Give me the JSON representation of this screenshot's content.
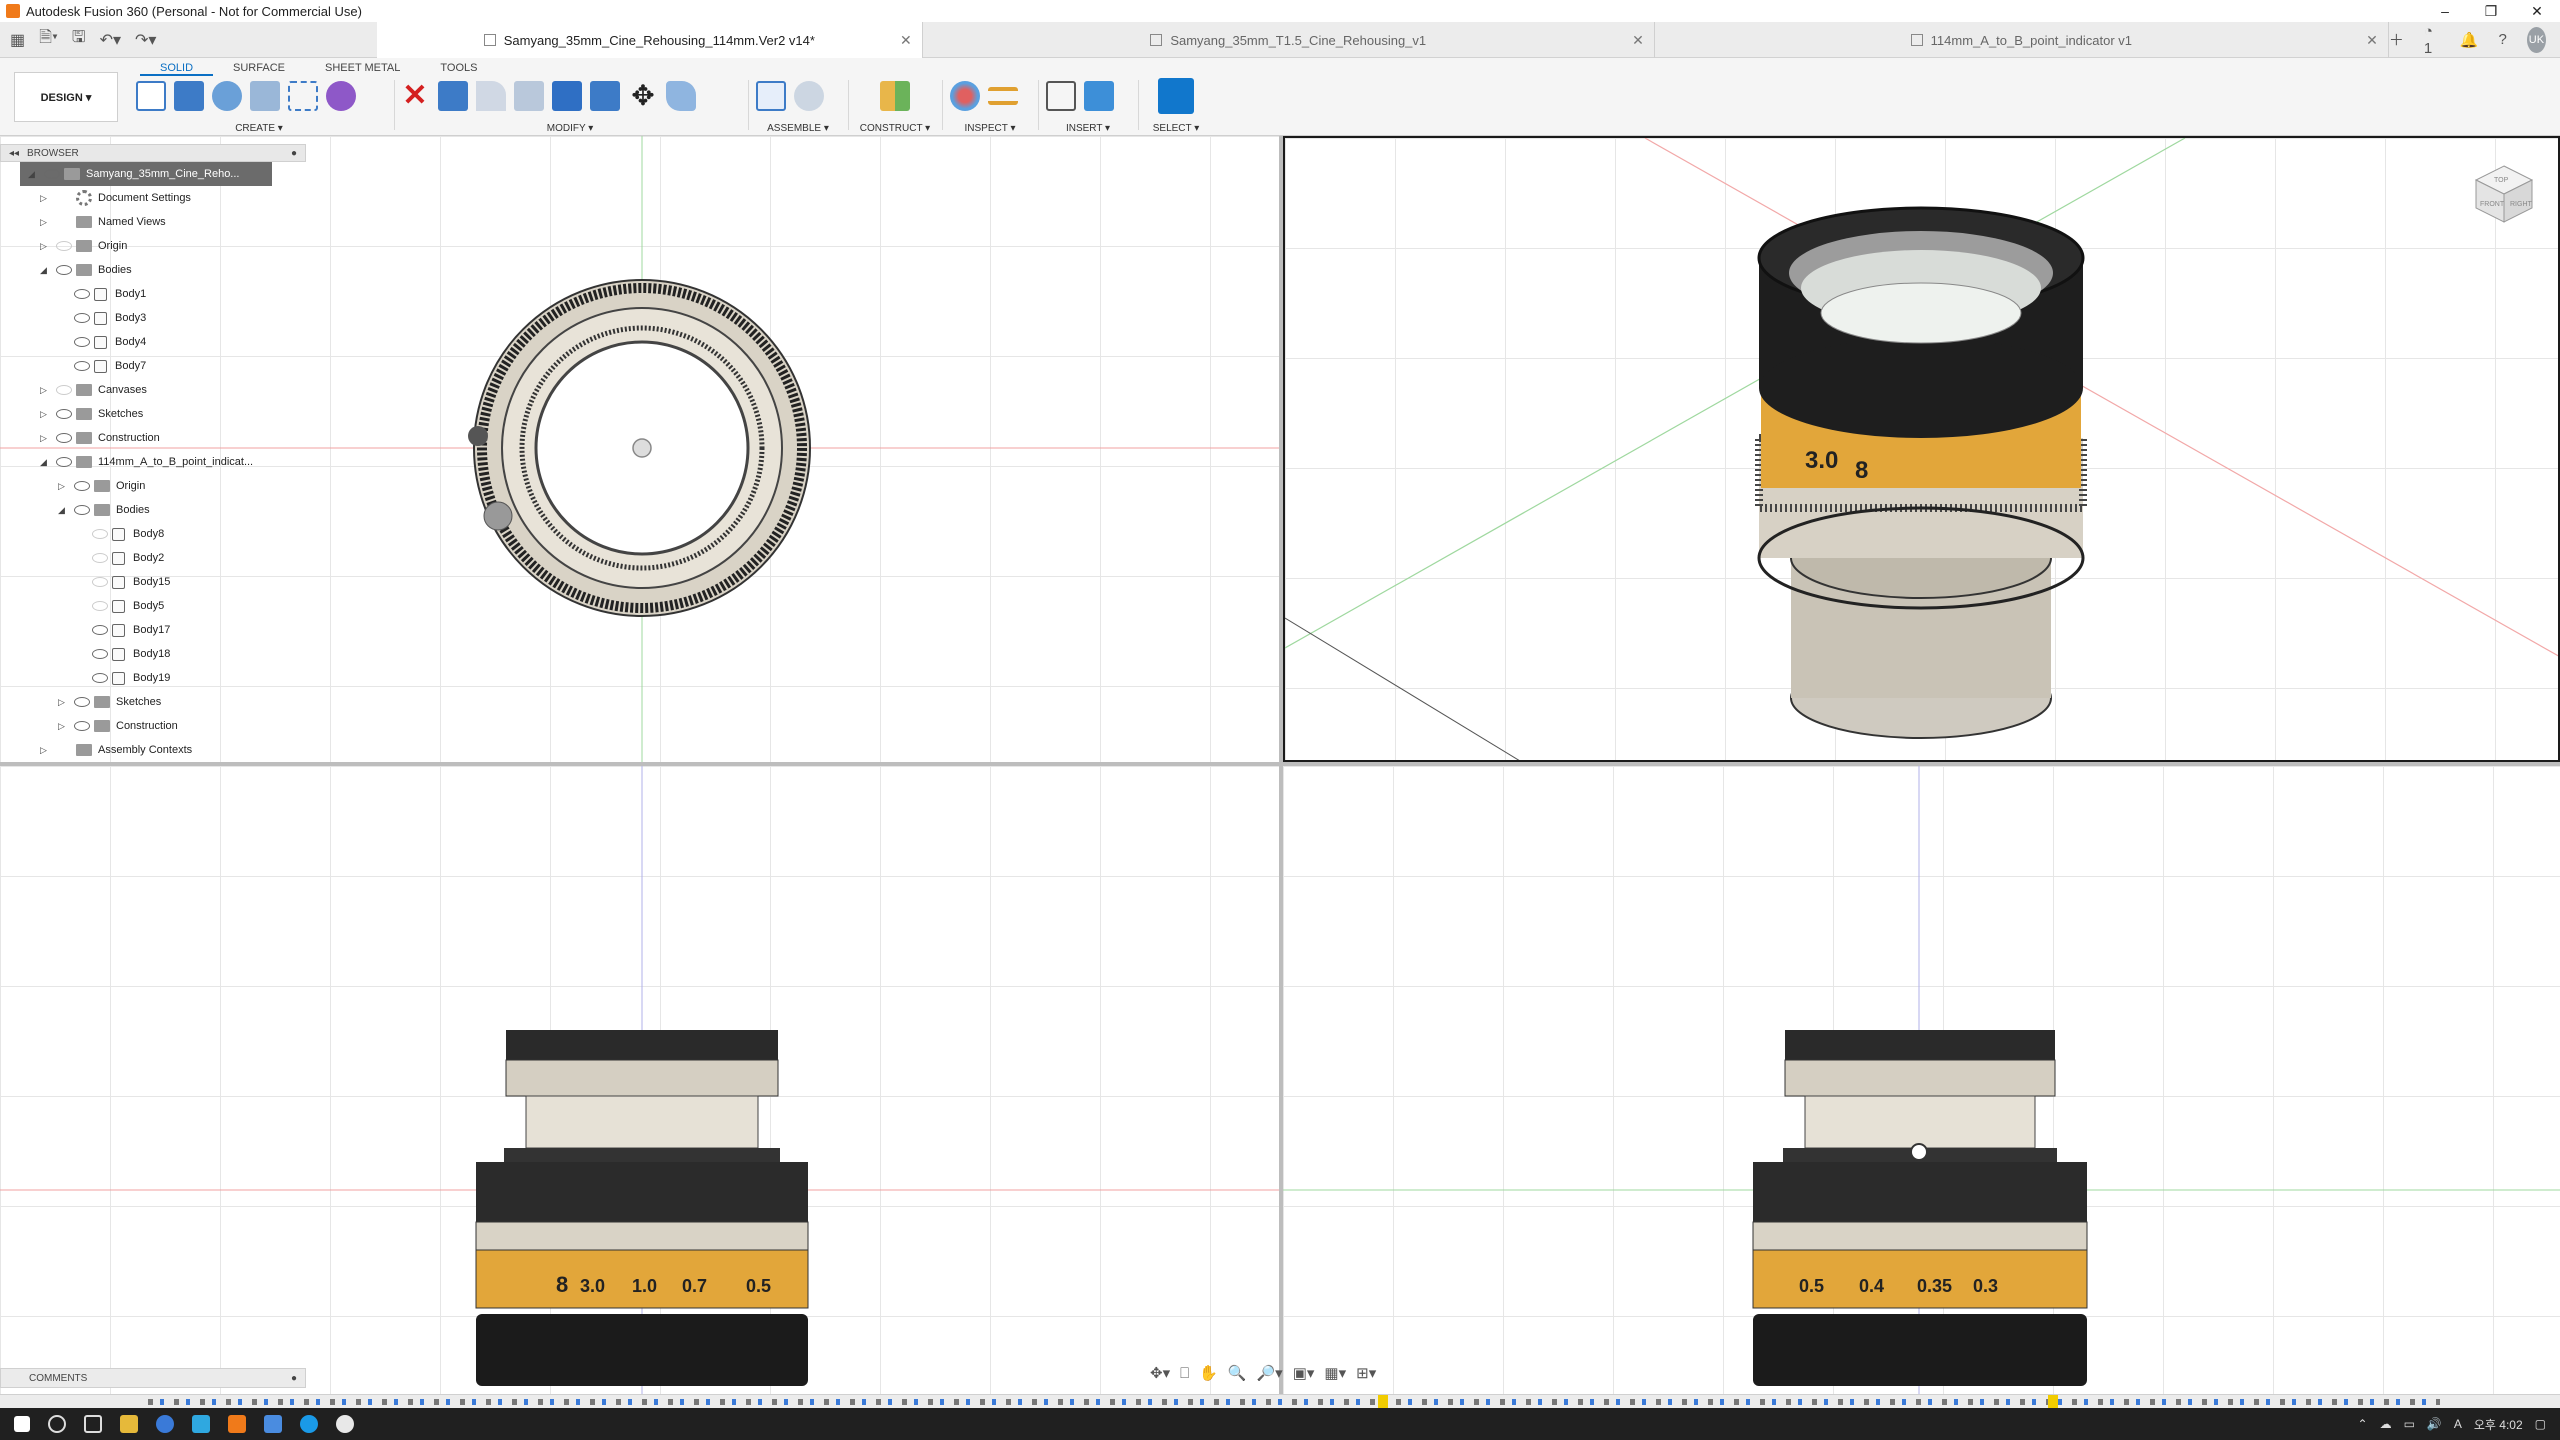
{
  "window": {
    "title": "Autodesk Fusion 360 (Personal - Not for Commercial Use)",
    "controls": [
      "–",
      "❐",
      "✕"
    ]
  },
  "tabs": [
    {
      "label": "Samyang_35mm_Cine_Rehousing_114mm.Ver2 v14*",
      "active": true
    },
    {
      "label": "Samyang_35mm_T1.5_Cine_Rehousing_v1",
      "active": false
    },
    {
      "label": "114mm_A_to_B_point_indicator v1",
      "active": false
    }
  ],
  "tab_right": {
    "jobs_count": "1",
    "user_initials": "UK"
  },
  "ribbon": {
    "workspace": "DESIGN ▾",
    "tabs": [
      "SOLID",
      "SURFACE",
      "SHEET METAL",
      "TOOLS"
    ],
    "groups": {
      "create": "CREATE ▾",
      "modify": "MODIFY ▾",
      "assemble": "ASSEMBLE ▾",
      "construct": "CONSTRUCT ▾",
      "inspect": "INSPECT ▾",
      "insert": "INSERT ▾",
      "select": "SELECT ▾"
    }
  },
  "browser": {
    "title": "BROWSER",
    "items": [
      {
        "label": "Samyang_35mm_Cine_Reho...",
        "indent": 0
      },
      {
        "label": "Document Settings",
        "indent": 1
      },
      {
        "label": "Named Views",
        "indent": 1
      },
      {
        "label": "Origin",
        "indent": 1
      },
      {
        "label": "Bodies",
        "indent": 1
      },
      {
        "label": "Body1",
        "indent": 2
      },
      {
        "label": "Body3",
        "indent": 2
      },
      {
        "label": "Body4",
        "indent": 2
      },
      {
        "label": "Body7",
        "indent": 2
      },
      {
        "label": "Canvases",
        "indent": 1
      },
      {
        "label": "Sketches",
        "indent": 1
      },
      {
        "label": "Construction",
        "indent": 1
      },
      {
        "label": "114mm_A_to_B_point_indicat...",
        "indent": 1
      },
      {
        "label": "Origin",
        "indent": 2
      },
      {
        "label": "Bodies",
        "indent": 2
      },
      {
        "label": "Body8",
        "indent": 3
      },
      {
        "label": "Body2",
        "indent": 3
      },
      {
        "label": "Body15",
        "indent": 3
      },
      {
        "label": "Body5",
        "indent": 3
      },
      {
        "label": "Body17",
        "indent": 3
      },
      {
        "label": "Body18",
        "indent": 3
      },
      {
        "label": "Body19",
        "indent": 3
      },
      {
        "label": "Sketches",
        "indent": 2
      },
      {
        "label": "Construction",
        "indent": 2
      },
      {
        "label": "Assembly Contexts",
        "indent": 1
      }
    ]
  },
  "comments": {
    "title": "COMMENTS"
  },
  "viewcube": {
    "top": "TOP",
    "front": "FRONT",
    "right": "RIGHT"
  },
  "lens_scale": {
    "front_marks": [
      "8",
      "3.0",
      "1.0",
      "0.7",
      "0.5"
    ],
    "side_marks": [
      "0.5",
      "0.4",
      "0.35",
      "0.3"
    ],
    "iso_marks": [
      "8",
      "3.0"
    ]
  },
  "taskbar": {
    "time": "오후 4:02"
  },
  "colors": {
    "accent": "#0a6fc4",
    "ring_gold": "#e2a63a",
    "ring_metal": "#d6d0c4"
  }
}
